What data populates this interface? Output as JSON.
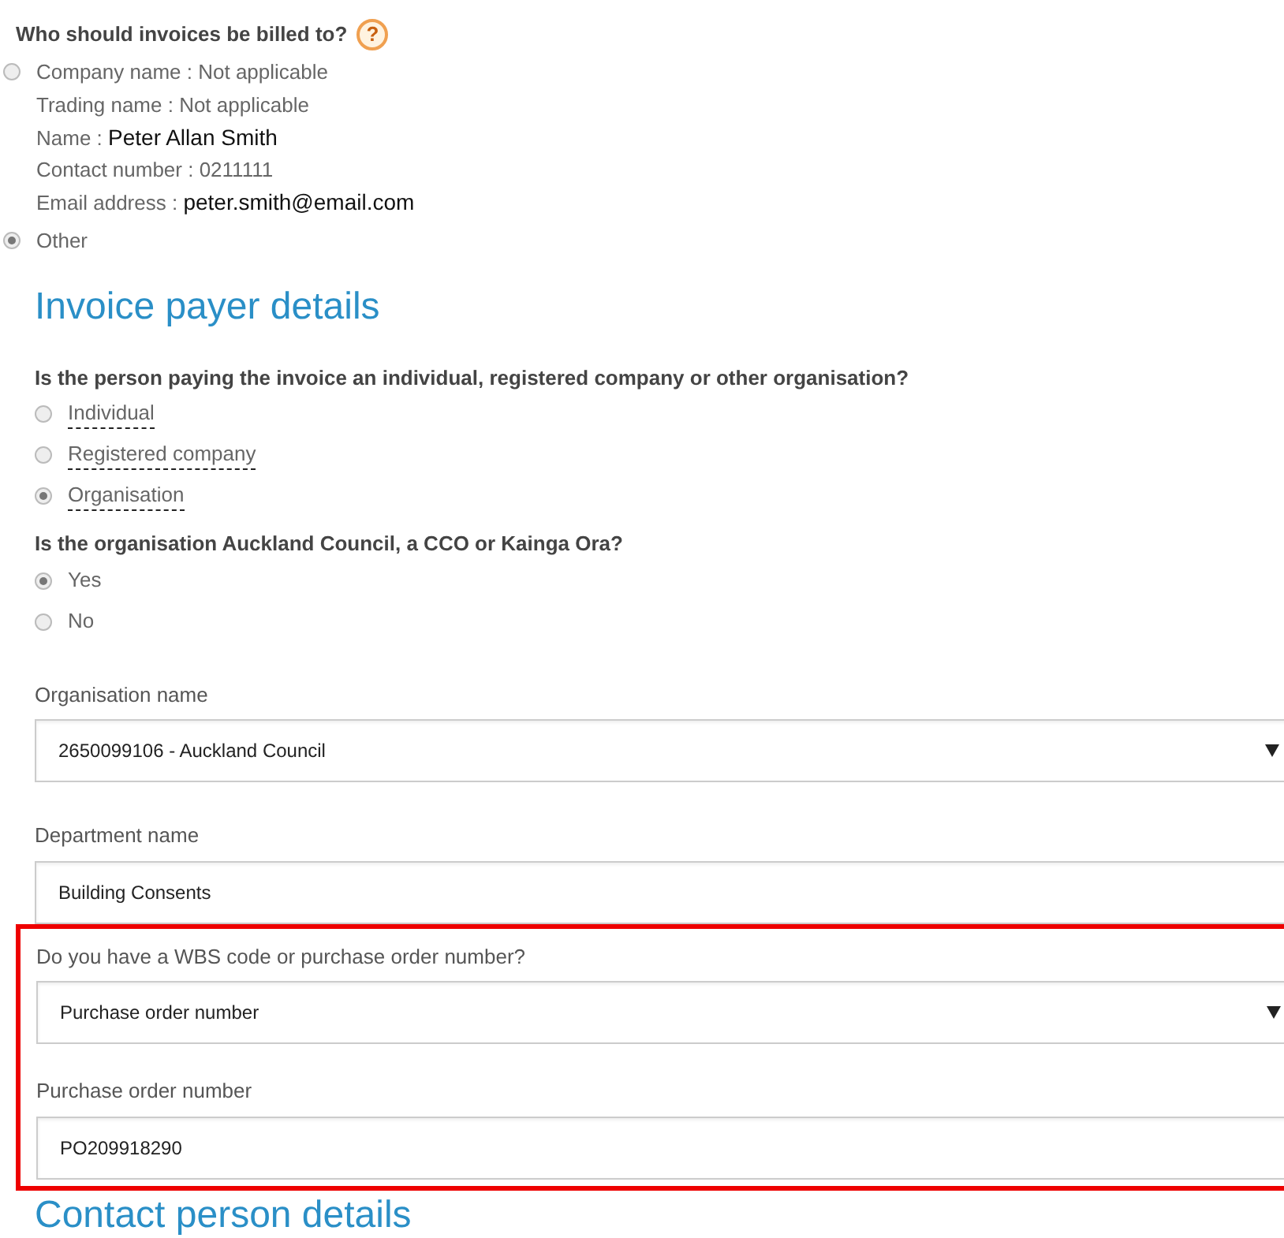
{
  "billing": {
    "question": "Who should invoices be billed to?",
    "help": "?",
    "options": [
      {
        "kind": "details",
        "selected": false,
        "lines": [
          {
            "label": "Company name :",
            "value": "Not applicable",
            "kind": "plain"
          },
          {
            "label": "Trading name :",
            "value": "Not applicable",
            "kind": "plain"
          },
          {
            "label": "Name :",
            "value": "Peter Allan Smith",
            "kind": "pasted"
          },
          {
            "label": "Contact number :",
            "value": "0211111",
            "kind": "plain"
          },
          {
            "label": "Email address :",
            "value": "peter.smith@email.com",
            "kind": "pasted"
          }
        ]
      },
      {
        "kind": "text",
        "selected": true,
        "label": "Other"
      }
    ]
  },
  "payer": {
    "heading": "Invoice payer details",
    "type_question": "Is the person paying the invoice an individual, registered company or other organisation?",
    "types": [
      {
        "label": "Individual",
        "selected": false
      },
      {
        "label": "Registered company",
        "selected": false
      },
      {
        "label": "Organisation",
        "selected": true
      }
    ],
    "council_question": "Is the organisation Auckland Council, a CCO or Kainga Ora?",
    "council": [
      {
        "label": "Yes",
        "selected": true
      },
      {
        "label": "No",
        "selected": false
      }
    ],
    "fields": [
      {
        "kind": "select",
        "label": "Organisation name",
        "value": "2650099106 - Auckland Council",
        "highlighted": false
      },
      {
        "kind": "text",
        "label": "Department name",
        "value": "Building Consents",
        "highlighted": false
      },
      {
        "kind": "select",
        "label": "Do you have a WBS code or purchase order number?",
        "value": "Purchase order number",
        "highlighted": true
      },
      {
        "kind": "text",
        "label": "Purchase order number",
        "value": "PO209918290",
        "highlighted": true
      }
    ]
  },
  "contact": {
    "heading": "Contact person details"
  }
}
